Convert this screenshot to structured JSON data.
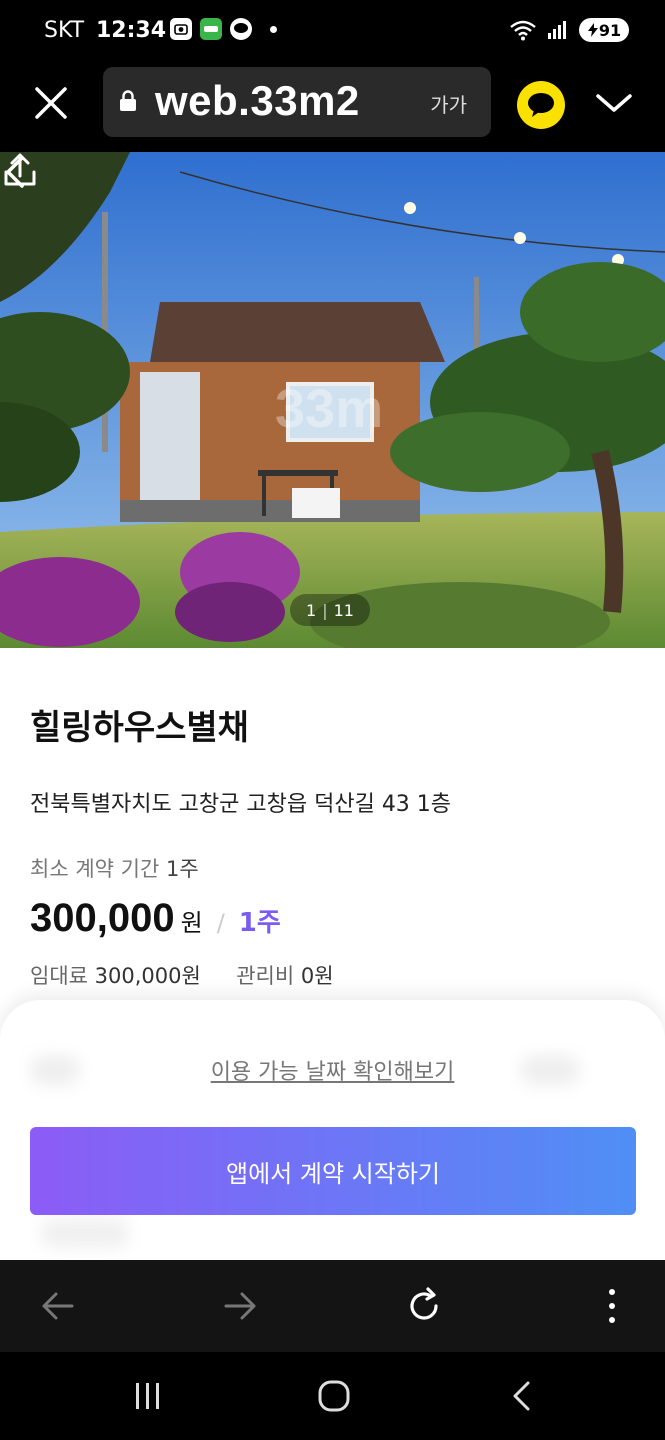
{
  "status_bar": {
    "carrier": "SKT",
    "time": "12:34",
    "notif_icons": [
      "camera-scan-icon",
      "one-app-icon",
      "kakaotalk-icon"
    ],
    "battery": "91"
  },
  "browser": {
    "url": "web.33m2",
    "font_size_label": "가가"
  },
  "gallery": {
    "current": "1",
    "total": "11"
  },
  "listing": {
    "title": "힐링하우스별채",
    "address": "전북특별자치도 고창군 고창읍 덕산길 43 1층",
    "min_term_label": "최소 계약 기간",
    "min_term_value": "1주",
    "price": "300,000",
    "price_unit": "원",
    "price_slash": "/",
    "price_period": "1주",
    "rent_label": "임대료",
    "rent_value": "300,000원",
    "fee_label": "관리비",
    "fee_value": "0원"
  },
  "sheet": {
    "availability_link": "이용 가능 날짜 확인해보기",
    "cta_label": "앱에서 계약 시작하기"
  },
  "colors": {
    "accent_purple": "#7b5cf0",
    "cta_gradient_start": "#8c5cf6",
    "cta_gradient_end": "#4f8ff5",
    "kakao_yellow": "#fae100"
  }
}
